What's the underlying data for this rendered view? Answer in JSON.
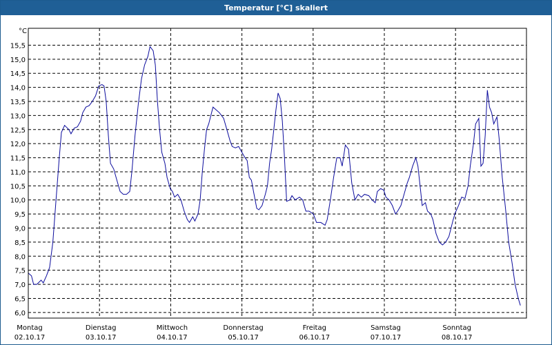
{
  "window": {
    "title": "Temperatur [°C] skaliert"
  },
  "colors": {
    "line": "#0a0a9c",
    "grid": "#000000",
    "title_bg": "#1f5f96"
  },
  "chart_data": {
    "type": "line",
    "title": "Temperatur [°C] skaliert",
    "ylabel": "°C",
    "ylim": [
      5.8,
      16.1
    ],
    "y_ticks": [
      "6,0",
      "6,5",
      "7,0",
      "7,5",
      "8,0",
      "8,5",
      "9,0",
      "9,5",
      "10,0",
      "10,5",
      "11,0",
      "11,5",
      "12,0",
      "12,5",
      "13,0",
      "13,5",
      "14,0",
      "14,5",
      "15,0",
      "15,5"
    ],
    "grid": true,
    "x_unit": "days since 02.10.17 00:00",
    "xlim": [
      0,
      7.0
    ],
    "days": [
      {
        "weekday": "Montag",
        "date": "02.10.17"
      },
      {
        "weekday": "Dienstag",
        "date": "03.10.17"
      },
      {
        "weekday": "Mittwoch",
        "date": "04.10.17"
      },
      {
        "weekday": "Donnerstag",
        "date": "05.10.17"
      },
      {
        "weekday": "Freitag",
        "date": "06.10.17"
      },
      {
        "weekday": "Samstag",
        "date": "07.10.17"
      },
      {
        "weekday": "Sonntag",
        "date": "08.10.17"
      }
    ],
    "series": [
      {
        "name": "",
        "points": [
          [
            0.0,
            7.4
          ],
          [
            0.03,
            7.3
          ],
          [
            0.05,
            7.0
          ],
          [
            0.08,
            7.0
          ],
          [
            0.12,
            7.15
          ],
          [
            0.14,
            7.05
          ],
          [
            0.17,
            7.3
          ],
          [
            0.2,
            7.6
          ],
          [
            0.23,
            8.5
          ],
          [
            0.26,
            10.0
          ],
          [
            0.29,
            11.5
          ],
          [
            0.31,
            12.4
          ],
          [
            0.34,
            12.65
          ],
          [
            0.38,
            12.5
          ],
          [
            0.4,
            12.35
          ],
          [
            0.43,
            12.55
          ],
          [
            0.46,
            12.6
          ],
          [
            0.49,
            12.8
          ],
          [
            0.51,
            13.1
          ],
          [
            0.54,
            13.3
          ],
          [
            0.57,
            13.35
          ],
          [
            0.6,
            13.5
          ],
          [
            0.63,
            13.7
          ],
          [
            0.66,
            14.05
          ],
          [
            0.69,
            14.1
          ],
          [
            0.71,
            14.05
          ],
          [
            0.73,
            13.5
          ],
          [
            0.75,
            12.3
          ],
          [
            0.77,
            11.3
          ],
          [
            0.8,
            11.1
          ],
          [
            0.83,
            10.7
          ],
          [
            0.86,
            10.3
          ],
          [
            0.89,
            10.2
          ],
          [
            0.92,
            10.2
          ],
          [
            0.95,
            10.3
          ],
          [
            0.97,
            11.0
          ],
          [
            1.0,
            12.3
          ],
          [
            1.03,
            13.4
          ],
          [
            1.06,
            14.3
          ],
          [
            1.09,
            14.8
          ],
          [
            1.12,
            15.1
          ],
          [
            1.14,
            15.45
          ],
          [
            1.17,
            15.3
          ],
          [
            1.19,
            14.8
          ],
          [
            1.21,
            13.5
          ],
          [
            1.23,
            12.5
          ],
          [
            1.25,
            11.7
          ],
          [
            1.28,
            11.3
          ],
          [
            1.3,
            10.8
          ],
          [
            1.33,
            10.4
          ],
          [
            1.35,
            10.3
          ],
          [
            1.37,
            10.1
          ],
          [
            1.4,
            10.2
          ],
          [
            1.43,
            10.0
          ],
          [
            1.46,
            9.6
          ],
          [
            1.49,
            9.3
          ],
          [
            1.51,
            9.2
          ],
          [
            1.54,
            9.4
          ],
          [
            1.56,
            9.25
          ],
          [
            1.59,
            9.5
          ],
          [
            1.61,
            10.0
          ],
          [
            1.63,
            11.0
          ],
          [
            1.65,
            11.8
          ],
          [
            1.67,
            12.5
          ],
          [
            1.69,
            12.7
          ],
          [
            1.71,
            13.0
          ],
          [
            1.73,
            13.3
          ],
          [
            1.76,
            13.2
          ],
          [
            1.79,
            13.1
          ],
          [
            1.83,
            12.9
          ],
          [
            1.86,
            12.5
          ],
          [
            1.89,
            12.1
          ],
          [
            1.91,
            11.9
          ],
          [
            1.94,
            11.85
          ],
          [
            1.97,
            11.9
          ],
          [
            2.0,
            11.7
          ],
          [
            2.03,
            11.5
          ],
          [
            2.05,
            11.4
          ],
          [
            2.07,
            10.8
          ],
          [
            2.09,
            10.7
          ],
          [
            2.11,
            10.3
          ],
          [
            2.14,
            9.7
          ],
          [
            2.16,
            9.65
          ],
          [
            2.19,
            9.8
          ],
          [
            2.22,
            10.2
          ],
          [
            2.24,
            10.5
          ],
          [
            2.26,
            11.3
          ],
          [
            2.28,
            11.8
          ],
          [
            2.3,
            12.5
          ],
          [
            2.32,
            13.2
          ],
          [
            2.34,
            13.8
          ],
          [
            2.36,
            13.6
          ],
          [
            2.38,
            12.8
          ],
          [
            2.4,
            11.5
          ],
          [
            2.42,
            9.95
          ],
          [
            2.45,
            10.0
          ],
          [
            2.47,
            10.15
          ],
          [
            2.5,
            10.0
          ],
          [
            2.54,
            10.1
          ],
          [
            2.57,
            10.0
          ],
          [
            2.6,
            9.6
          ],
          [
            2.63,
            9.6
          ],
          [
            2.67,
            9.5
          ],
          [
            2.7,
            9.2
          ],
          [
            2.74,
            9.2
          ],
          [
            2.78,
            9.1
          ],
          [
            2.8,
            9.3
          ],
          [
            2.83,
            10.0
          ],
          [
            2.86,
            10.8
          ],
          [
            2.89,
            11.5
          ],
          [
            2.92,
            11.5
          ],
          [
            2.94,
            11.2
          ],
          [
            2.97,
            11.95
          ],
          [
            3.0,
            11.8
          ],
          [
            3.03,
            10.6
          ],
          [
            3.06,
            10.0
          ],
          [
            3.09,
            10.2
          ],
          [
            3.12,
            10.1
          ],
          [
            3.15,
            10.2
          ],
          [
            3.19,
            10.15
          ],
          [
            3.22,
            10.0
          ],
          [
            3.25,
            9.9
          ],
          [
            3.27,
            10.3
          ],
          [
            3.3,
            10.4
          ],
          [
            3.33,
            10.35
          ],
          [
            3.35,
            10.1
          ],
          [
            3.38,
            10.0
          ],
          [
            3.41,
            9.8
          ],
          [
            3.44,
            9.5
          ],
          [
            3.46,
            9.6
          ],
          [
            3.49,
            9.8
          ],
          [
            3.52,
            10.2
          ],
          [
            3.55,
            10.6
          ],
          [
            3.57,
            10.8
          ],
          [
            3.6,
            11.2
          ],
          [
            3.63,
            11.5
          ],
          [
            3.65,
            11.2
          ],
          [
            3.67,
            10.5
          ],
          [
            3.69,
            9.8
          ],
          [
            3.72,
            9.9
          ],
          [
            3.74,
            9.6
          ],
          [
            3.77,
            9.5
          ],
          [
            3.79,
            9.3
          ],
          [
            3.82,
            8.8
          ],
          [
            3.85,
            8.5
          ],
          [
            3.88,
            8.4
          ],
          [
            3.91,
            8.5
          ],
          [
            3.94,
            8.7
          ],
          [
            3.96,
            9.0
          ],
          [
            3.98,
            9.3
          ],
          [
            4.0,
            9.55
          ],
          [
            4.03,
            9.8
          ],
          [
            4.06,
            10.1
          ],
          [
            4.09,
            10.05
          ],
          [
            4.12,
            10.5
          ],
          [
            4.14,
            11.2
          ],
          [
            4.17,
            12.0
          ],
          [
            4.19,
            12.7
          ],
          [
            4.22,
            12.9
          ],
          [
            4.24,
            11.2
          ],
          [
            4.26,
            11.3
          ],
          [
            4.28,
            12.3
          ],
          [
            4.3,
            13.9
          ],
          [
            4.32,
            13.3
          ],
          [
            4.34,
            13.1
          ],
          [
            4.36,
            12.7
          ],
          [
            4.39,
            12.95
          ],
          [
            4.41,
            12.2
          ],
          [
            4.44,
            10.8
          ],
          [
            4.47,
            9.7
          ],
          [
            4.5,
            8.5
          ],
          [
            4.53,
            7.8
          ],
          [
            4.56,
            7.0
          ],
          [
            4.59,
            6.5
          ],
          [
            4.61,
            6.25
          ]
        ]
      }
    ],
    "x_points_scale": 1.5
  }
}
